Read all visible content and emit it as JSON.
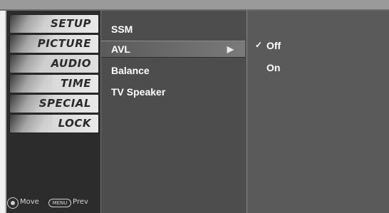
{
  "sidebar": {
    "items": [
      {
        "label": "SETUP",
        "icon": "setup-icon"
      },
      {
        "label": "PICTURE",
        "icon": "picture-icon"
      },
      {
        "label": "AUDIO",
        "icon": "audio-icon"
      },
      {
        "label": "TIME",
        "icon": "clock-icon"
      },
      {
        "label": "SPECIAL",
        "icon": "special-icon"
      },
      {
        "label": "LOCK",
        "icon": "lock-icon"
      }
    ],
    "footer": {
      "move": "Move",
      "menu_key": "MENU",
      "prev": "Prev"
    }
  },
  "menu": {
    "items": [
      {
        "label": "SSM"
      },
      {
        "label": "AVL",
        "arrow": "▶"
      },
      {
        "label": "Balance"
      },
      {
        "label": "TV Speaker"
      }
    ]
  },
  "submenu": {
    "items": [
      {
        "label": "Off",
        "check": "✓"
      },
      {
        "label": "On",
        "check": ""
      }
    ]
  },
  "colors": {
    "menu_bg": "#4d4d4d",
    "submenu_bg": "#5a5a5a",
    "sidebar_bg": "#2c2c2c"
  }
}
